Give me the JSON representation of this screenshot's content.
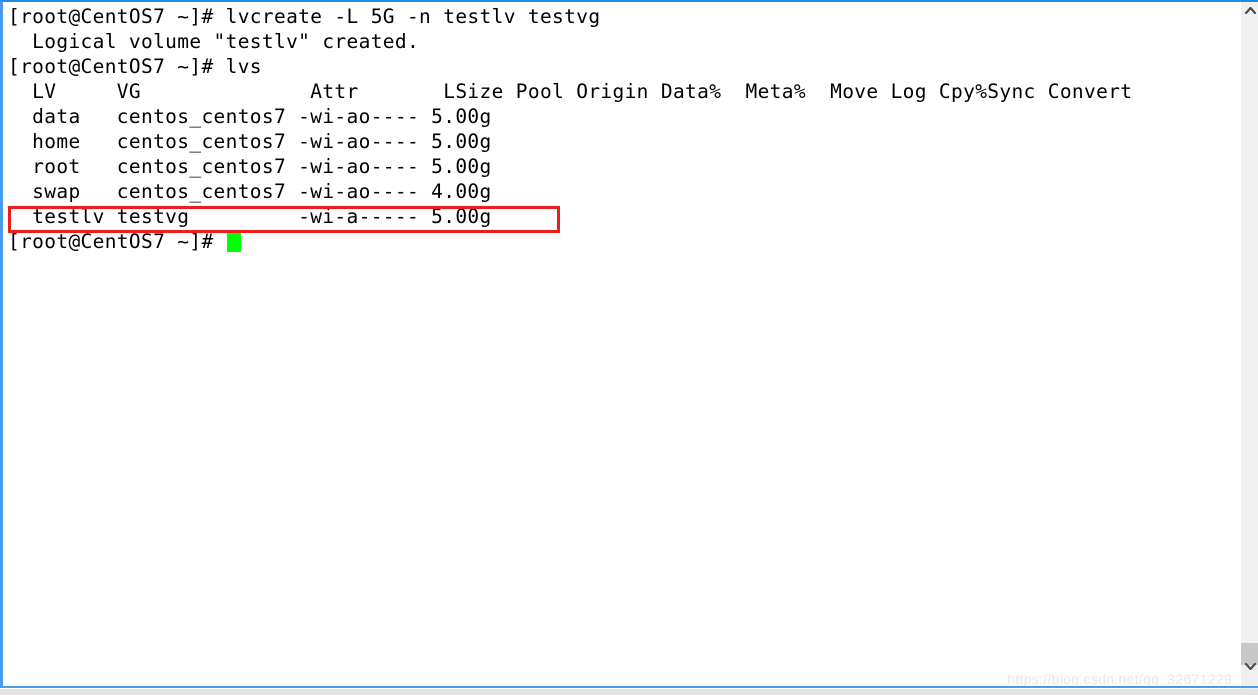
{
  "window": {
    "app": "terminal",
    "border_color": "#4a9bf0",
    "background": "#ffffff",
    "foreground": "#000000"
  },
  "terminal": {
    "lines": [
      "[root@CentOS7 ~]# lvcreate -L 5G -n testlv testvg",
      "  Logical volume \"testlv\" created.",
      "[root@CentOS7 ~]# lvs",
      "  LV     VG              Attr       LSize Pool Origin Data%  Meta%  Move Log Cpy%Sync Convert",
      "  data   centos_centos7 -wi-ao---- 5.00g",
      "  home   centos_centos7 -wi-ao---- 5.00g",
      "  root   centos_centos7 -wi-ao---- 5.00g",
      "  swap   centos_centos7 -wi-ao---- 4.00g",
      "  testlv testvg         -wi-a----- 5.00g"
    ],
    "prompt": "[root@CentOS7 ~]# ",
    "cursor_color": "#00ff00"
  },
  "commands": {
    "first": "lvcreate -L 5G -n testlv testvg",
    "first_output": "Logical volume \"testlv\" created.",
    "second": "lvs"
  },
  "lvs_table": {
    "headers": [
      "LV",
      "VG",
      "Attr",
      "LSize",
      "Pool",
      "Origin",
      "Data%",
      "Meta%",
      "Move",
      "Log",
      "Cpy%Sync",
      "Convert"
    ],
    "rows": [
      {
        "lv": "data",
        "vg": "centos_centos7",
        "attr": "-wi-ao----",
        "lsize": "5.00g",
        "highlighted": false
      },
      {
        "lv": "home",
        "vg": "centos_centos7",
        "attr": "-wi-ao----",
        "lsize": "5.00g",
        "highlighted": false
      },
      {
        "lv": "root",
        "vg": "centos_centos7",
        "attr": "-wi-ao----",
        "lsize": "5.00g",
        "highlighted": false
      },
      {
        "lv": "swap",
        "vg": "centos_centos7",
        "attr": "-wi-ao----",
        "lsize": "4.00g",
        "highlighted": false
      },
      {
        "lv": "testlv",
        "vg": "testvg",
        "attr": "-wi-a-----",
        "lsize": "5.00g",
        "highlighted": true
      }
    ]
  },
  "annotation": {
    "type": "rectangle",
    "color": "#ee1c1c",
    "target_row": "testlv"
  },
  "watermark": {
    "text": "https://blog.csdn.net/qq_32671229"
  },
  "scrollbar": {
    "up_icon": "chevron-up-icon",
    "down_icon": "chevron-down-icon",
    "thumb_position": "bottom"
  }
}
